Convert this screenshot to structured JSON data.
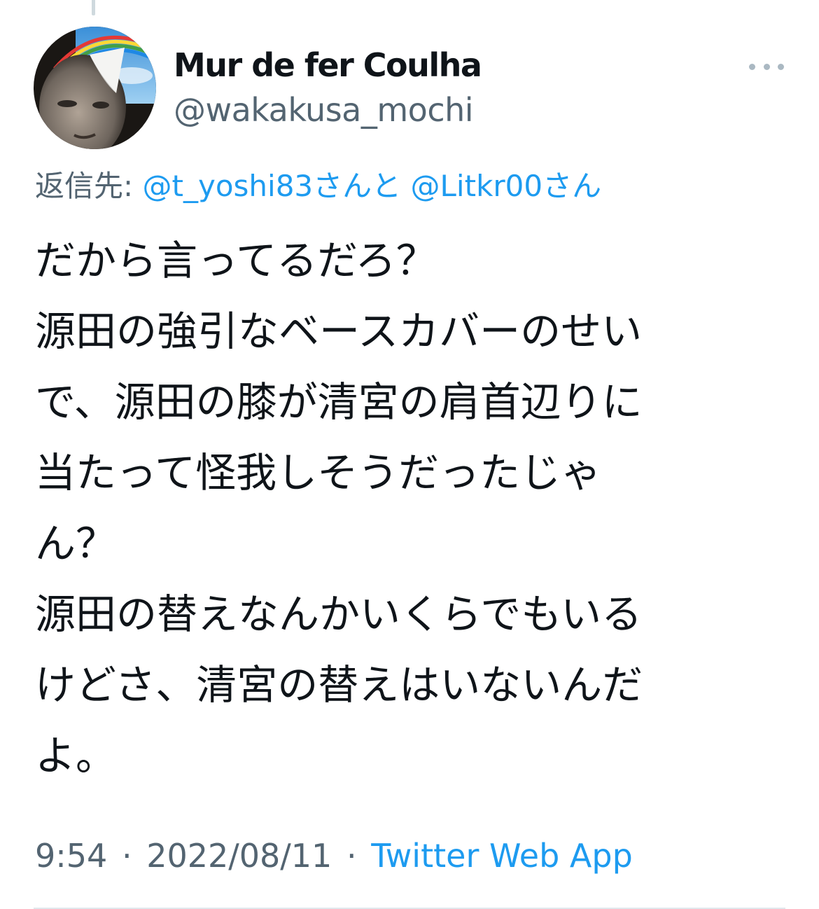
{
  "user": {
    "display_name": "Mur de fer Coulha",
    "handle": "@wakakusa_mochi",
    "avatar_icon": "avatar-image"
  },
  "reply": {
    "label": "返信先:",
    "mention1": "@t_yoshi83",
    "joiner": "さんと",
    "mention2": "@Litkr00",
    "suffix": "さん"
  },
  "tweet": {
    "lines": [
      "だから言ってるだろ？",
      "源田の強引なベースカバーのせい",
      "で、源田の膝が清宮の肩首辺りに",
      "当たって怪我しそうだったじゃ",
      "ん？",
      "源田の替えなんかいくらでもいる",
      "けどさ、清宮の替えはいないんだ",
      "よ。"
    ]
  },
  "meta": {
    "time": "9:54",
    "separator": "·",
    "date": "2022/08/11",
    "source": "Twitter Web App"
  },
  "colors": {
    "text": "#0f1419",
    "secondary": "#536471",
    "link": "#1d9bf0"
  },
  "icons": {
    "more": "more-options-icon"
  }
}
